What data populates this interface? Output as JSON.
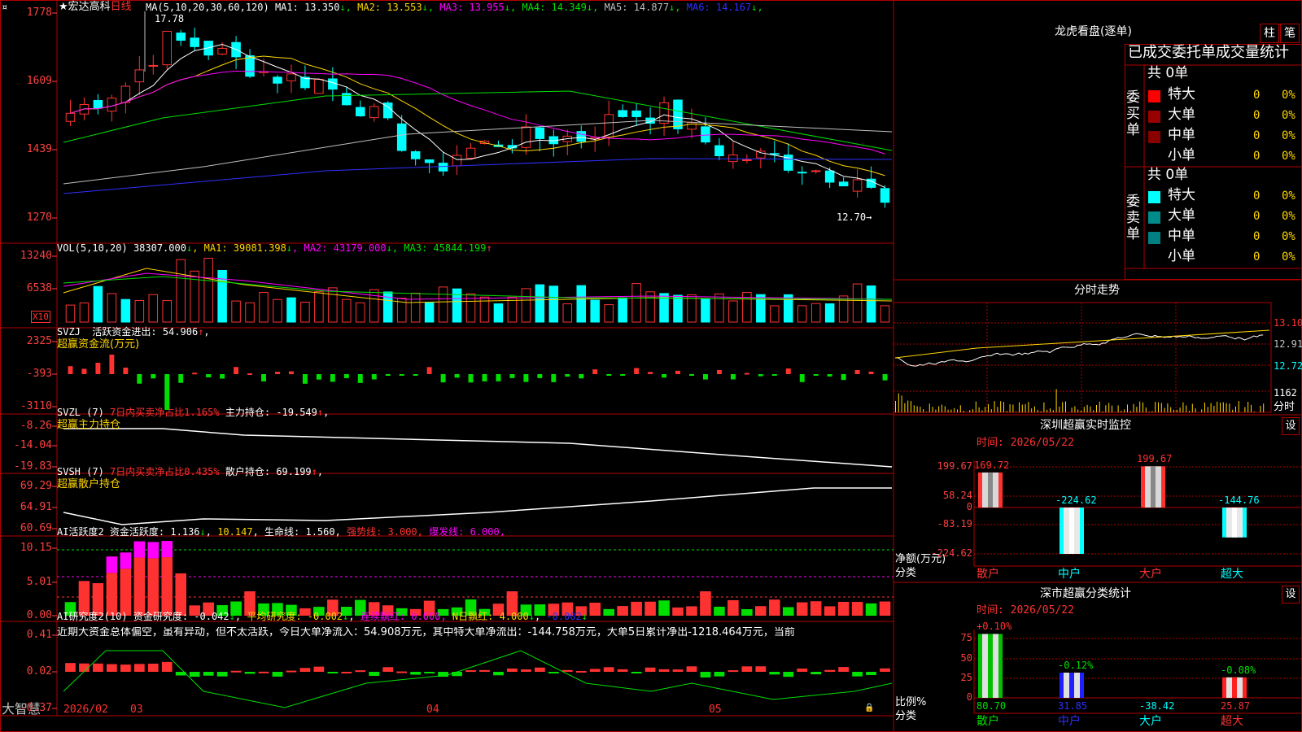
{
  "colors": {
    "frame": "#b00000",
    "up": "#ff3232",
    "down": "#00ffff",
    "green": "#00e000",
    "yellow": "#ffd700",
    "magenta": "#ff00ff",
    "white": "#ffffff",
    "blue": "#3030ff",
    "grey": "#c0c0c0",
    "text": "#c0c0c0",
    "axis_red": "#ff4040"
  },
  "stock": {
    "star": "★",
    "name": "宏达高科",
    "period": "日线",
    "ma_params": "MA(5,10,20,30,60,120)",
    "ma": [
      {
        "label": "MA1:",
        "value": "13.350",
        "arrow": "↓",
        "color": "#ffffff"
      },
      {
        "label": "MA2:",
        "value": "13.553",
        "arrow": "↓",
        "color": "#ffd700"
      },
      {
        "label": "MA3:",
        "value": "13.955",
        "arrow": "↓",
        "color": "#ff00ff"
      },
      {
        "label": "MA4:",
        "value": "14.349",
        "arrow": "↓",
        "color": "#00e000"
      },
      {
        "label": "MA5:",
        "value": "14.877",
        "arrow": "↓",
        "color": "#c0c0c0"
      },
      {
        "label": "MA6:",
        "value": "14.167",
        "arrow": "↓",
        "color": "#3030ff"
      }
    ],
    "high_label": "17.78",
    "low_label": "12.70→",
    "axis": [
      "1778",
      "1609",
      "1439",
      "1270"
    ]
  },
  "volume": {
    "title": "VOL(5,10,20)",
    "vol": "38307.000",
    "ma": [
      {
        "label": "MA1:",
        "value": "39081.398",
        "arrow": "↓",
        "color": "#ffd700"
      },
      {
        "label": "MA2:",
        "value": "43179.000",
        "arrow": "↓",
        "color": "#ff00ff"
      },
      {
        "label": "MA3:",
        "value": "45844.199",
        "arrow": "↑",
        "color": "#00e000"
      }
    ],
    "axis": [
      "13240",
      "6538"
    ],
    "unit": "X10"
  },
  "svzj": {
    "title": "SVZJ",
    "label": "活跃资金进出:",
    "value": "54.906",
    "arrow": "↑",
    "sub": "超赢资金流(万元)",
    "axis": [
      "2325",
      "-393",
      "-3110"
    ]
  },
  "svzl": {
    "title": "SVZL (7)",
    "ratio": "7日内买卖净占比1.165%",
    "label": "主力持仓:",
    "value": "-19.549",
    "arrow": "↑",
    "sub": "超赢主力持仓",
    "axis": [
      "-8.26",
      "-14.04",
      "-19.83"
    ]
  },
  "svsh": {
    "title": "SVSH (7)",
    "ratio": "7日内买卖净占比0.435%",
    "label": "散户持仓:",
    "value": "69.199",
    "arrow": "↑",
    "sub": "超赢散户持仓",
    "axis": [
      "69.29",
      "64.91",
      "60.69"
    ]
  },
  "ai_active": {
    "title": "AI活跃度2",
    "label": "资金活跃度:",
    "value": "1.136",
    "arrow": "↓",
    "value2": "10.147",
    "life_label": "生命线:",
    "life_value": "1.560",
    "strong_label": "强势线:",
    "strong_value": "3.000",
    "burst_label": "爆发线:",
    "burst_value": "6.000",
    "axis": [
      "10.15",
      "5.01",
      "0.00"
    ]
  },
  "ai_research": {
    "title": "AI研究度2(10)",
    "label": "资金研究度:",
    "value": "-0.042",
    "avg_label": "平均研究度:",
    "avg_value": "-0.002",
    "red_label": "连续飘红:",
    "red_value": "0.000",
    "nred_label": "N日飘红:",
    "nred_value": "4.000",
    "last": "-0.002",
    "comment": "近期大资金总体偏空，虽有异动，但不太活跃，今日大单净流入：54.908万元，其中特大单净流出：-144.758万元，大单5日累计净出-1218.464万元，当前",
    "axis": [
      "0.41",
      "0.02",
      "-0.37"
    ]
  },
  "bottom": {
    "brand": "大智慧",
    "dates": [
      "2026/02",
      "03",
      "04",
      "05"
    ]
  },
  "longhu": {
    "title": "龙虎看盘(逐单)",
    "btn_zhu": "柱",
    "btn_bi": "笔",
    "header": "已成交委托单成交量统计",
    "buy_label": "委买单",
    "sell_label": "委卖单",
    "buy_total": "共 0单",
    "sell_total": "共 0单",
    "buy_rows": [
      {
        "color": "#ff0000",
        "name": "特大",
        "count": "0",
        "pct": "0%"
      },
      {
        "color": "#990000",
        "name": "大单",
        "count": "0",
        "pct": "0%"
      },
      {
        "color": "#880000",
        "name": "中单",
        "count": "0",
        "pct": "0%"
      },
      {
        "color": "",
        "name": "小单",
        "count": "0",
        "pct": "0%"
      }
    ],
    "sell_rows": [
      {
        "color": "#00ffff",
        "name": "特大",
        "count": "0",
        "pct": "0%"
      },
      {
        "color": "#008b8b",
        "name": "大单",
        "count": "0",
        "pct": "0%"
      },
      {
        "color": "#008080",
        "name": "中单",
        "count": "0",
        "pct": "0%"
      },
      {
        "color": "",
        "name": "小单",
        "count": "0",
        "pct": "0%"
      }
    ]
  },
  "intraday": {
    "title": "分时走势",
    "axis_price": [
      "13.10",
      "12.91",
      "12.72"
    ],
    "axis_vol": "1162",
    "unit": "分时"
  },
  "sz_monitor": {
    "title": "深圳超赢实时监控",
    "set": "设",
    "time": "时间: 2026/05/22",
    "axis": [
      "199.67",
      "58.24",
      "0",
      "-83.19",
      "-224.62"
    ],
    "unit": "净额(万元)",
    "cat_label": "分类",
    "categories": [
      "散户",
      "中户",
      "大户",
      "超大"
    ],
    "values": [
      169.72,
      -224.62,
      199.67,
      -144.76
    ],
    "value_labels": [
      "169.72",
      "-224.62",
      "199.67",
      "-144.76"
    ]
  },
  "sz_class": {
    "title": "深市超赢分类统计",
    "set": "设",
    "time": "时间: 2026/05/22",
    "axis": [
      "75",
      "50",
      "25",
      "0"
    ],
    "unit": "比例%",
    "cat_label": "分类",
    "categories": [
      "散户",
      "中户",
      "大户",
      "超大"
    ],
    "values": [
      80.7,
      31.85,
      -38.42,
      25.87
    ],
    "changes": [
      "+0.10%",
      "-0.12%",
      "",
      "-0.08%"
    ]
  }
}
